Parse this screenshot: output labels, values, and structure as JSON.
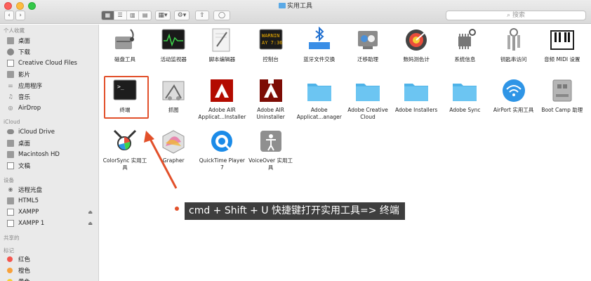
{
  "window": {
    "title": "实用工具"
  },
  "toolbar": {
    "back": "‹",
    "forward": "›",
    "views": [
      "▦",
      "☰",
      "▥",
      "▤"
    ],
    "arrange": "▦▾",
    "action": "⚙▾",
    "share": "⇧",
    "tag": "◯",
    "search_placeholder": "搜索"
  },
  "sidebar": {
    "favorites_header": "个人收藏",
    "favorites": [
      "桌面",
      "下载",
      "Creative Cloud Files",
      "影片",
      "应用程序",
      "音乐",
      "AirDrop"
    ],
    "icloud_header": "iCloud",
    "icloud": [
      "iCloud Drive",
      "桌面",
      "Macintosh HD",
      "文稿"
    ],
    "devices_header": "设备",
    "devices": [
      "远程光盘",
      "HTML5",
      "XAMPP",
      "XAMPP 1"
    ],
    "shared_header": "共享的",
    "tags_header": "标记",
    "tags": [
      {
        "label": "红色",
        "color": "#f4564e"
      },
      {
        "label": "橙色",
        "color": "#f8a13b"
      },
      {
        "label": "黄色",
        "color": "#f5cf36"
      }
    ]
  },
  "apps": [
    {
      "label": "磁盘工具",
      "icon": "disk-utility-icon"
    },
    {
      "label": "活动监视器",
      "icon": "activity-monitor-icon"
    },
    {
      "label": "脚本编辑器",
      "icon": "script-editor-icon"
    },
    {
      "label": "控制台",
      "icon": "console-icon",
      "screen_text": "WARNIN AY 7:36"
    },
    {
      "label": "蓝牙文件交换",
      "icon": "bluetooth-icon"
    },
    {
      "label": "迁移助理",
      "icon": "migration-assistant-icon"
    },
    {
      "label": "数码测色计",
      "icon": "color-meter-icon"
    },
    {
      "label": "系统信息",
      "icon": "system-info-icon"
    },
    {
      "label": "钥匙串访问",
      "icon": "keychain-icon"
    },
    {
      "label": "音频 MIDI 设置",
      "icon": "audio-midi-icon"
    },
    {
      "label": "终端",
      "icon": "terminal-icon",
      "screen_text": ">_"
    },
    {
      "label": "抓图",
      "icon": "grab-icon"
    },
    {
      "label": "Adobe AIR Applicat...Installer",
      "icon": "adobe-air-icon"
    },
    {
      "label": "Adobe AIR Uninstaller",
      "icon": "adobe-air-uninstaller-icon"
    },
    {
      "label": "Adobe Applicat...anager",
      "icon": "folder-icon"
    },
    {
      "label": "Adobe Creative Cloud",
      "icon": "folder-icon"
    },
    {
      "label": "Adobe Installers",
      "icon": "folder-icon"
    },
    {
      "label": "Adobe Sync",
      "icon": "folder-icon"
    },
    {
      "label": "AirPort 实用工具",
      "icon": "airport-icon"
    },
    {
      "label": "Boot Camp 助理",
      "icon": "bootcamp-icon"
    },
    {
      "label": "ColorSync 实用工具",
      "icon": "colorsync-icon"
    },
    {
      "label": "Grapher",
      "icon": "grapher-icon"
    },
    {
      "label": "QuickTime Player 7",
      "icon": "quicktime-icon"
    },
    {
      "label": "VoiceOver 实用工具",
      "icon": "voiceover-icon"
    }
  ],
  "annotation": {
    "text": "cmd + Shift + U  快捷键打开实用工具=> 终端",
    "color": "#e2502a"
  }
}
